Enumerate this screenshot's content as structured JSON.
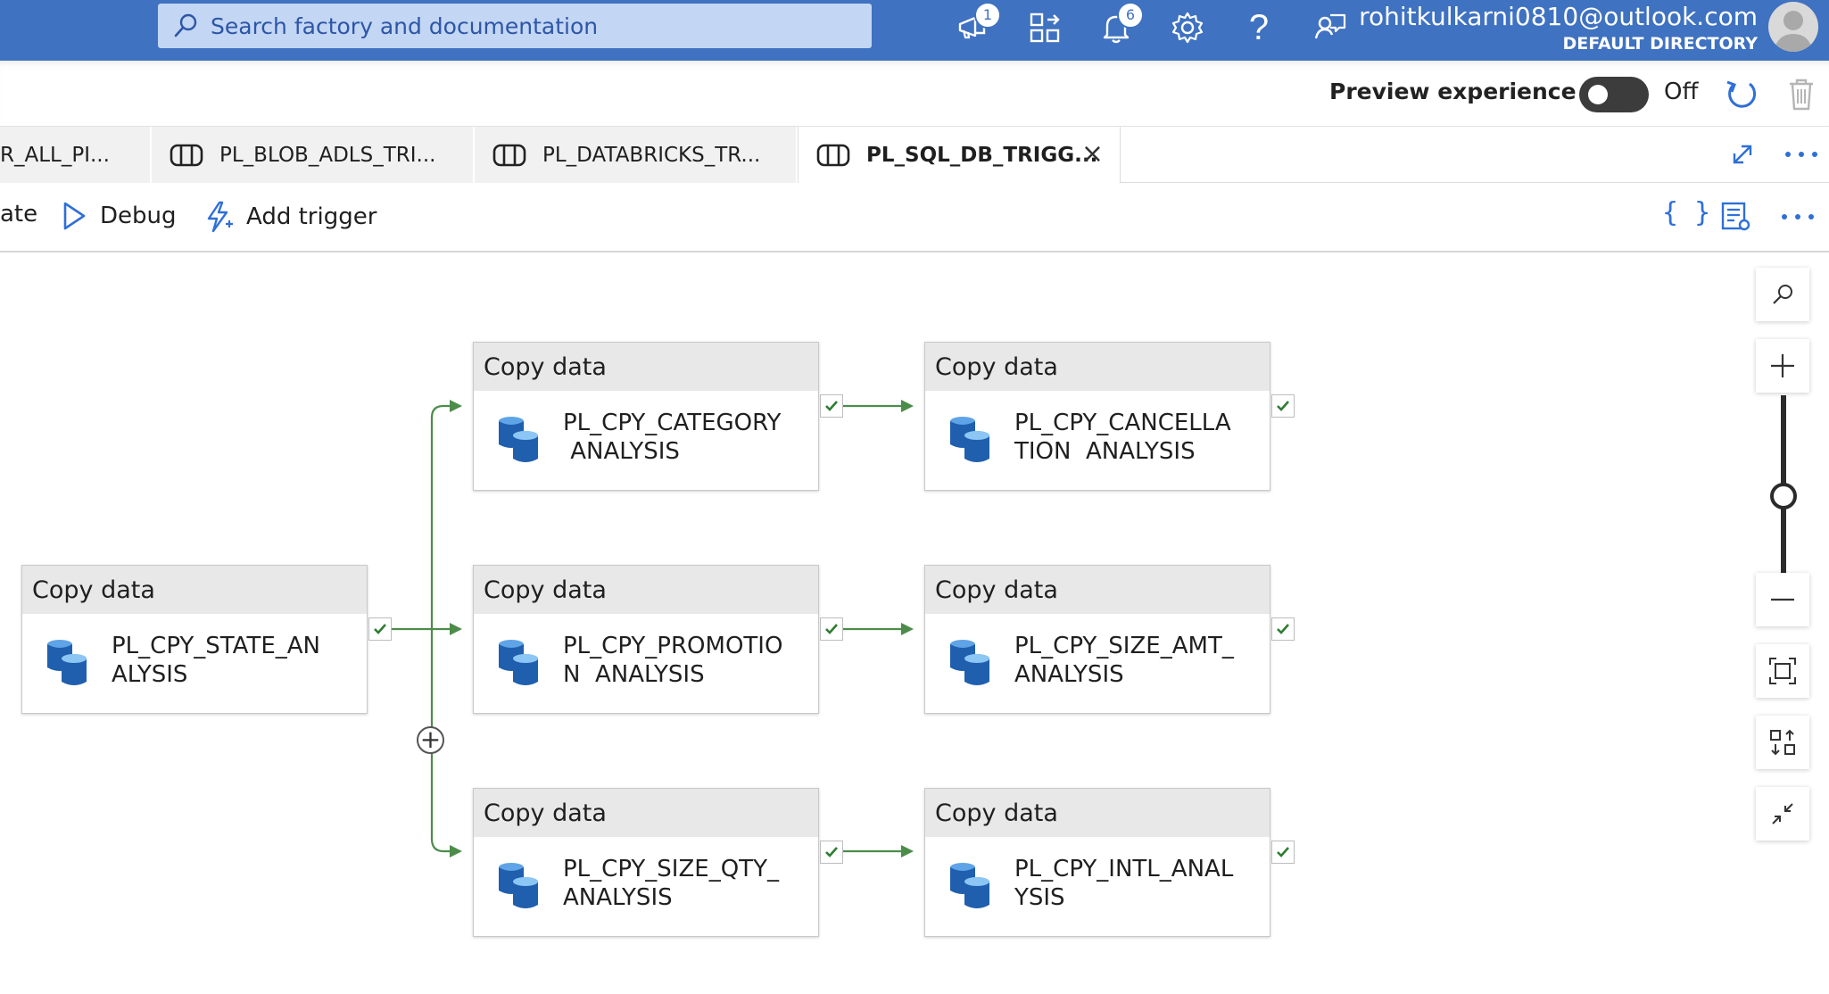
{
  "search": {
    "placeholder": "Search factory and documentation"
  },
  "header": {
    "icons": [
      {
        "name": "announcements-icon",
        "badge": "1"
      },
      {
        "name": "switch-directory-icon",
        "badge": ""
      },
      {
        "name": "notifications-icon",
        "badge": "6"
      },
      {
        "name": "settings-icon",
        "badge": ""
      },
      {
        "name": "help-icon",
        "badge": ""
      },
      {
        "name": "feedback-icon",
        "badge": ""
      }
    ],
    "help_glyph": "?",
    "user_email": "rohitkulkarni0810@outlook.com",
    "directory": "DEFAULT DIRECTORY"
  },
  "preview": {
    "label": "Preview experience",
    "toggle_state": "Off"
  },
  "tabs": [
    {
      "label": "R_ALL_PI...",
      "active": false
    },
    {
      "label": "PL_BLOB_ADLS_TRI...",
      "active": false
    },
    {
      "label": "PL_DATABRICKS_TR...",
      "active": false
    },
    {
      "label": "PL_SQL_DB_TRIGG...",
      "active": true,
      "close_glyph": "×"
    }
  ],
  "toolbar": {
    "partial_label": "ate",
    "debug_label": "Debug",
    "add_trigger_label": "Add trigger",
    "code_glyph": "{ }",
    "more_glyph": "···"
  },
  "activities": [
    {
      "type": "Copy data",
      "name": "PL_CPY_STATE_AN\nALYSIS"
    },
    {
      "type": "Copy data",
      "name": "PL_CPY_CATEGORY\n ANALYSIS"
    },
    {
      "type": "Copy data",
      "name": "PL_CPY_CANCELLA\nTION  ANALYSIS"
    },
    {
      "type": "Copy data",
      "name": "PL_CPY_PROMOTIO\nN  ANALYSIS"
    },
    {
      "type": "Copy data",
      "name": "PL_CPY_SIZE_AMT_\nANALYSIS"
    },
    {
      "type": "Copy data",
      "name": "PL_CPY_SIZE_QTY_\nANALYSIS"
    },
    {
      "type": "Copy data",
      "name": "PL_CPY_INTL_ANAL\nYSIS"
    }
  ],
  "canvas": {
    "add_glyph": "+"
  },
  "zoom": {
    "slider_level": 0.5
  },
  "colors": {
    "header": "#3f72c0",
    "accent": "#2f6fd6",
    "success": "#2e7d32",
    "connector": "#4c8c4a"
  }
}
